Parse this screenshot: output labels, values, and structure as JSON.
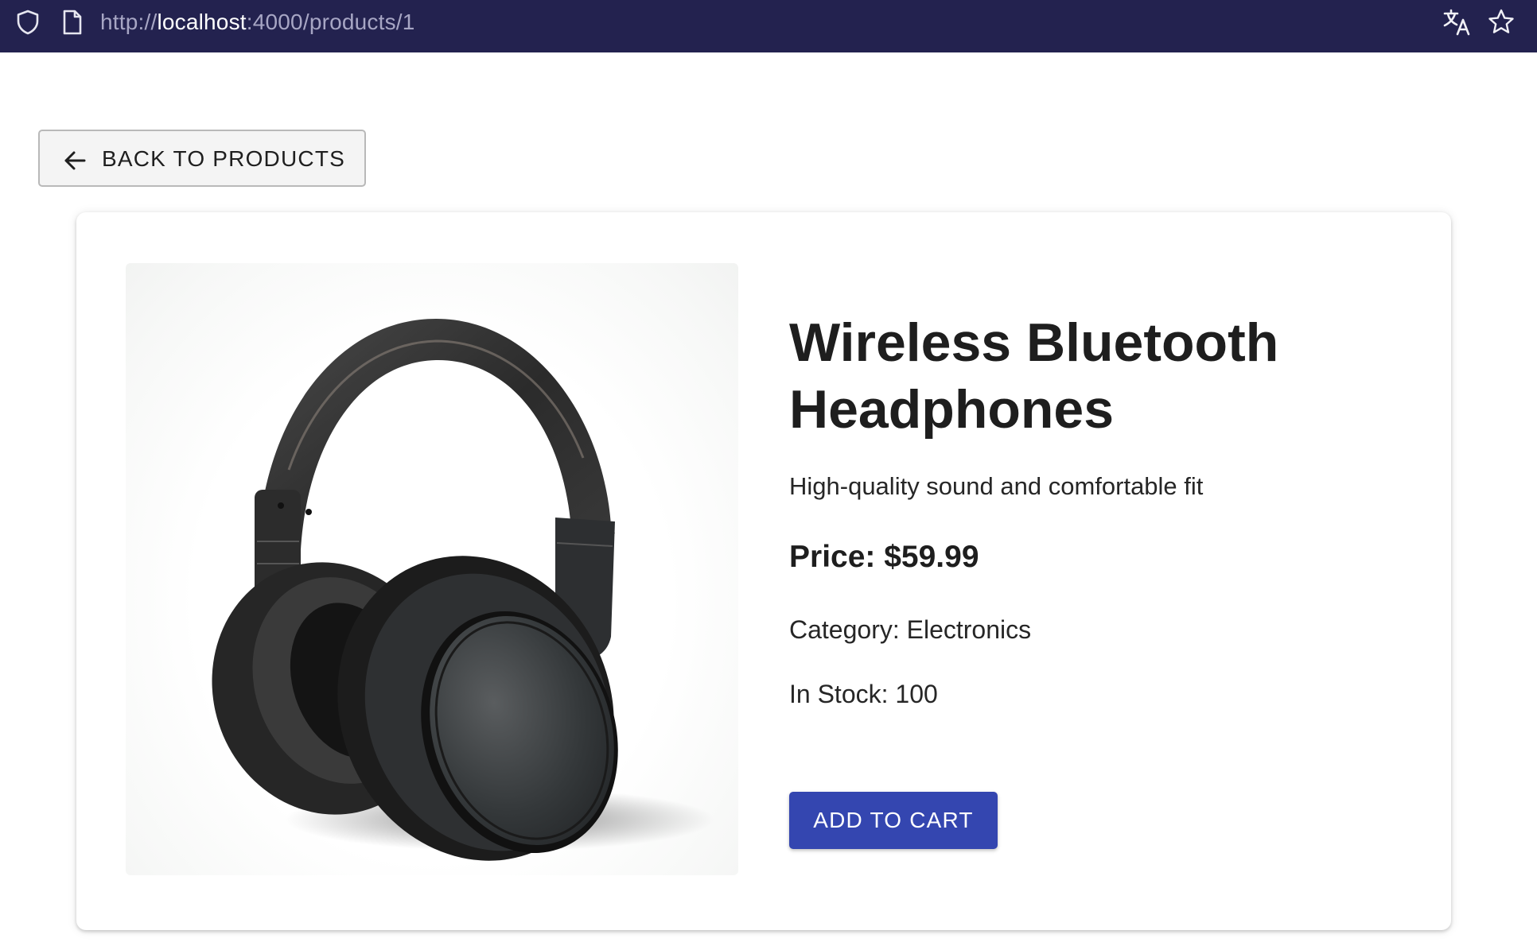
{
  "browser": {
    "url_scheme": "http://",
    "url_host": "localhost",
    "url_rest": ":4000/products/1",
    "icons": [
      "shield-icon",
      "page-icon",
      "translate-icon",
      "star-icon"
    ]
  },
  "navigation": {
    "back_label": "BACK TO PRODUCTS"
  },
  "product": {
    "image_alt": "Wireless Bluetooth Headphones",
    "title": "Wireless Bluetooth Headphones",
    "description": "High-quality sound and comfortable fit",
    "price_text": "Price: $59.99",
    "category_text": "Category: Electronics",
    "stock_text": "In Stock: 100",
    "add_to_cart_label": "ADD TO CART"
  },
  "colors": {
    "browser_bar": "#23224f",
    "primary_button": "#3446b0",
    "text": "#1e1e1e"
  }
}
